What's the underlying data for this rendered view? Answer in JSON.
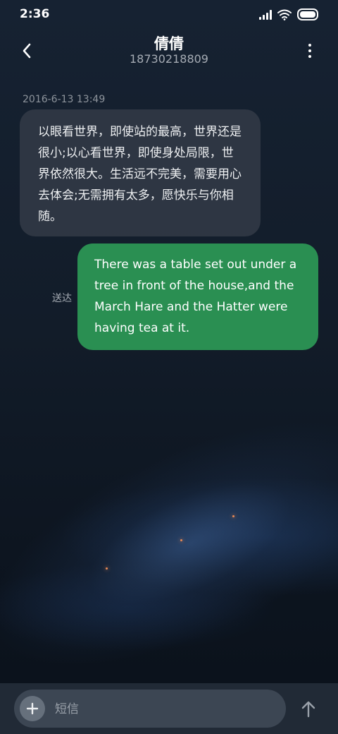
{
  "status_bar": {
    "time": "2:36",
    "icons": [
      "signal-icon",
      "wifi-icon",
      "battery-icon"
    ]
  },
  "header": {
    "contact_name": "倩倩",
    "contact_number": "18730218809",
    "back_icon": "chevron-left-icon",
    "more_icon": "more-vertical-icon"
  },
  "conversation": {
    "timestamp": "2016-6-13 13:49",
    "incoming_message": "以眼看世界，即使站的最高，世界还是很小;以心看世界，即使身处局限，世界依然很大。生活远不完美，需要用心去体会;无需拥有太多，愿快乐与你相随。",
    "outgoing_message": "There was a table set out under a tree in front of the house,and the March Hare and the Hatter were having tea at it.",
    "outgoing_status": "送达"
  },
  "composer": {
    "placeholder": "短信",
    "attach_icon": "plus-icon",
    "send_icon": "arrow-up-icon"
  },
  "colors": {
    "outgoing_bubble": "#2a8f52",
    "incoming_bubble": "#343c48",
    "background": "#121c29"
  }
}
